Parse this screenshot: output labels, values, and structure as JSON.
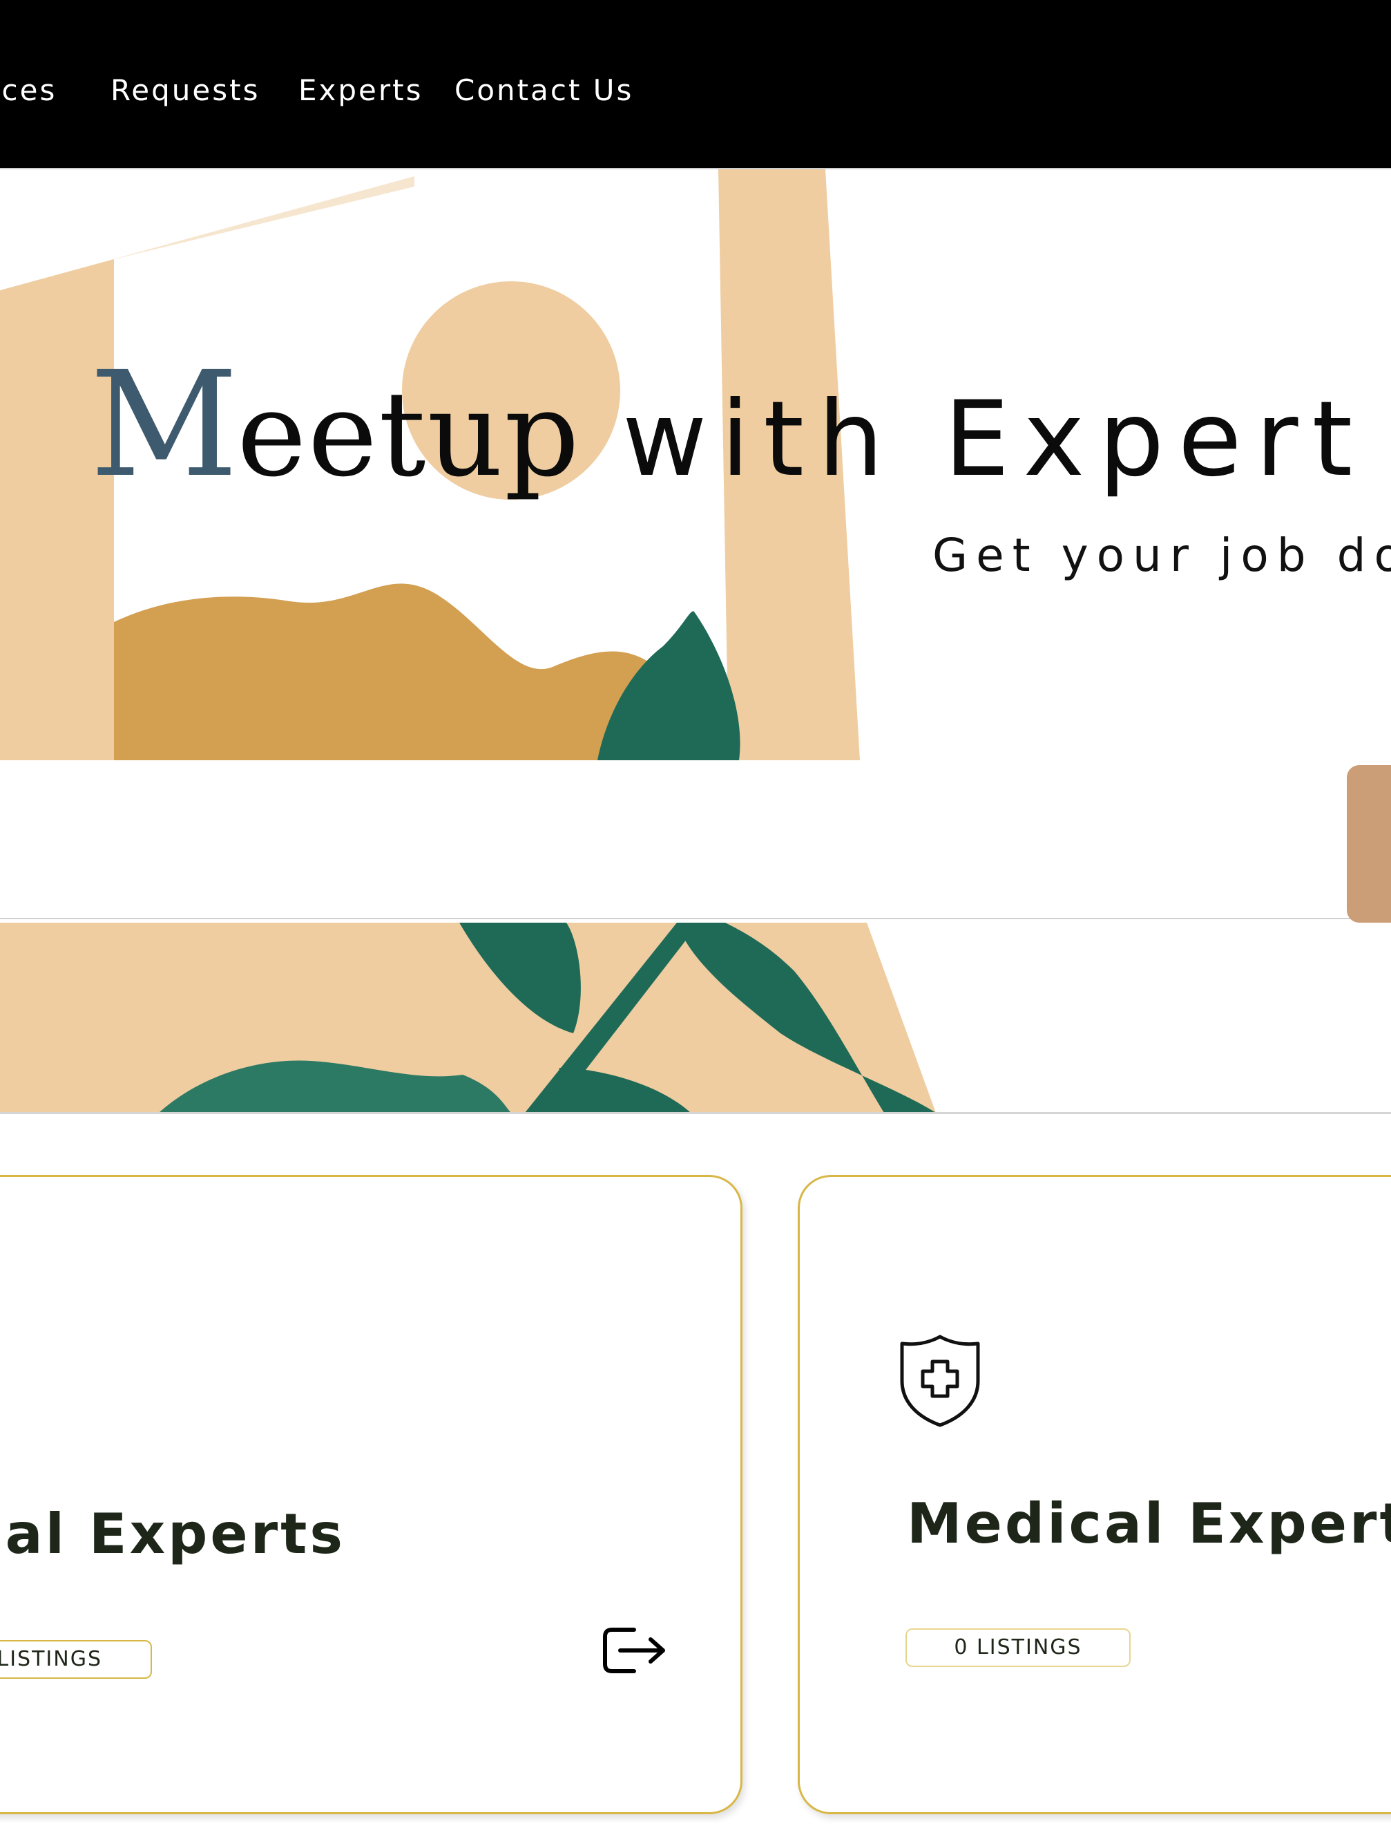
{
  "nav": {
    "items": [
      {
        "label": "vices"
      },
      {
        "label": "Requests"
      },
      {
        "label": "Experts"
      },
      {
        "label": "Contact Us"
      }
    ]
  },
  "hero": {
    "title_accent_letter": "M",
    "title_serif_rest": "eetup",
    "title_sans_rest": "with Expert",
    "subtitle": "Get your job do"
  },
  "cards": [
    {
      "title": "gal Experts",
      "listings": "LISTINGS",
      "icon": "exit-icon"
    },
    {
      "title": "Medical Experts",
      "listings": "0 LISTINGS",
      "icon": "shield-plus-icon"
    }
  ],
  "colors": {
    "nav_bg": "#000000",
    "title_accent": "#3e5a6e",
    "card_border": "#d8b746",
    "card_title": "#1d2618",
    "search_button": "#cc9e78",
    "art_sand": "#efcda1",
    "art_ochre": "#d39f51",
    "art_leaf": "#1f6a57"
  }
}
